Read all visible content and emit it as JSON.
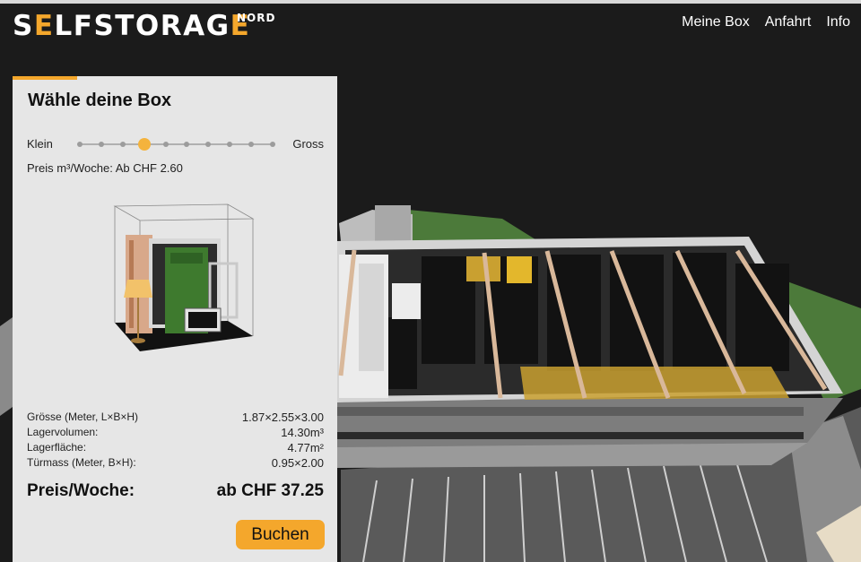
{
  "header": {
    "logo": {
      "prefix": "S",
      "accent_1": "E",
      "middle": "LFSTORAG",
      "accent_2": "E",
      "suffix": "NORD"
    },
    "nav": [
      {
        "label": "Meine Box"
      },
      {
        "label": "Anfahrt"
      },
      {
        "label": "Info"
      }
    ]
  },
  "panel": {
    "title": "Wähle deine Box",
    "slider": {
      "min_label": "Klein",
      "max_label": "Gross",
      "steps": 10,
      "selected_index": 3
    },
    "price_rate": "Preis m³/Woche: Ab CHF 2.60",
    "specs": [
      {
        "label": "Grösse (Meter, L×B×H)",
        "value": "1.87×2.55×3.00"
      },
      {
        "label": "Lagervolumen:",
        "value": "14.30m³"
      },
      {
        "label": "Lagerfläche:",
        "value": "4.77m²"
      },
      {
        "label": "Türmass (Meter, B×H):",
        "value": "0.95×2.00"
      }
    ],
    "price_week": {
      "label": "Preis/Woche:",
      "value": "ab CHF 37.25"
    },
    "book_label": "Buchen"
  },
  "colors": {
    "accent": "#f4a72c",
    "panel_bg": "#e6e6e6",
    "scene_bg": "#1b1b1b",
    "box_dark": "#1a1a1a",
    "box_selected": "#c9a030",
    "grass": "#4c7a3a",
    "beam": "#d9b89a"
  }
}
